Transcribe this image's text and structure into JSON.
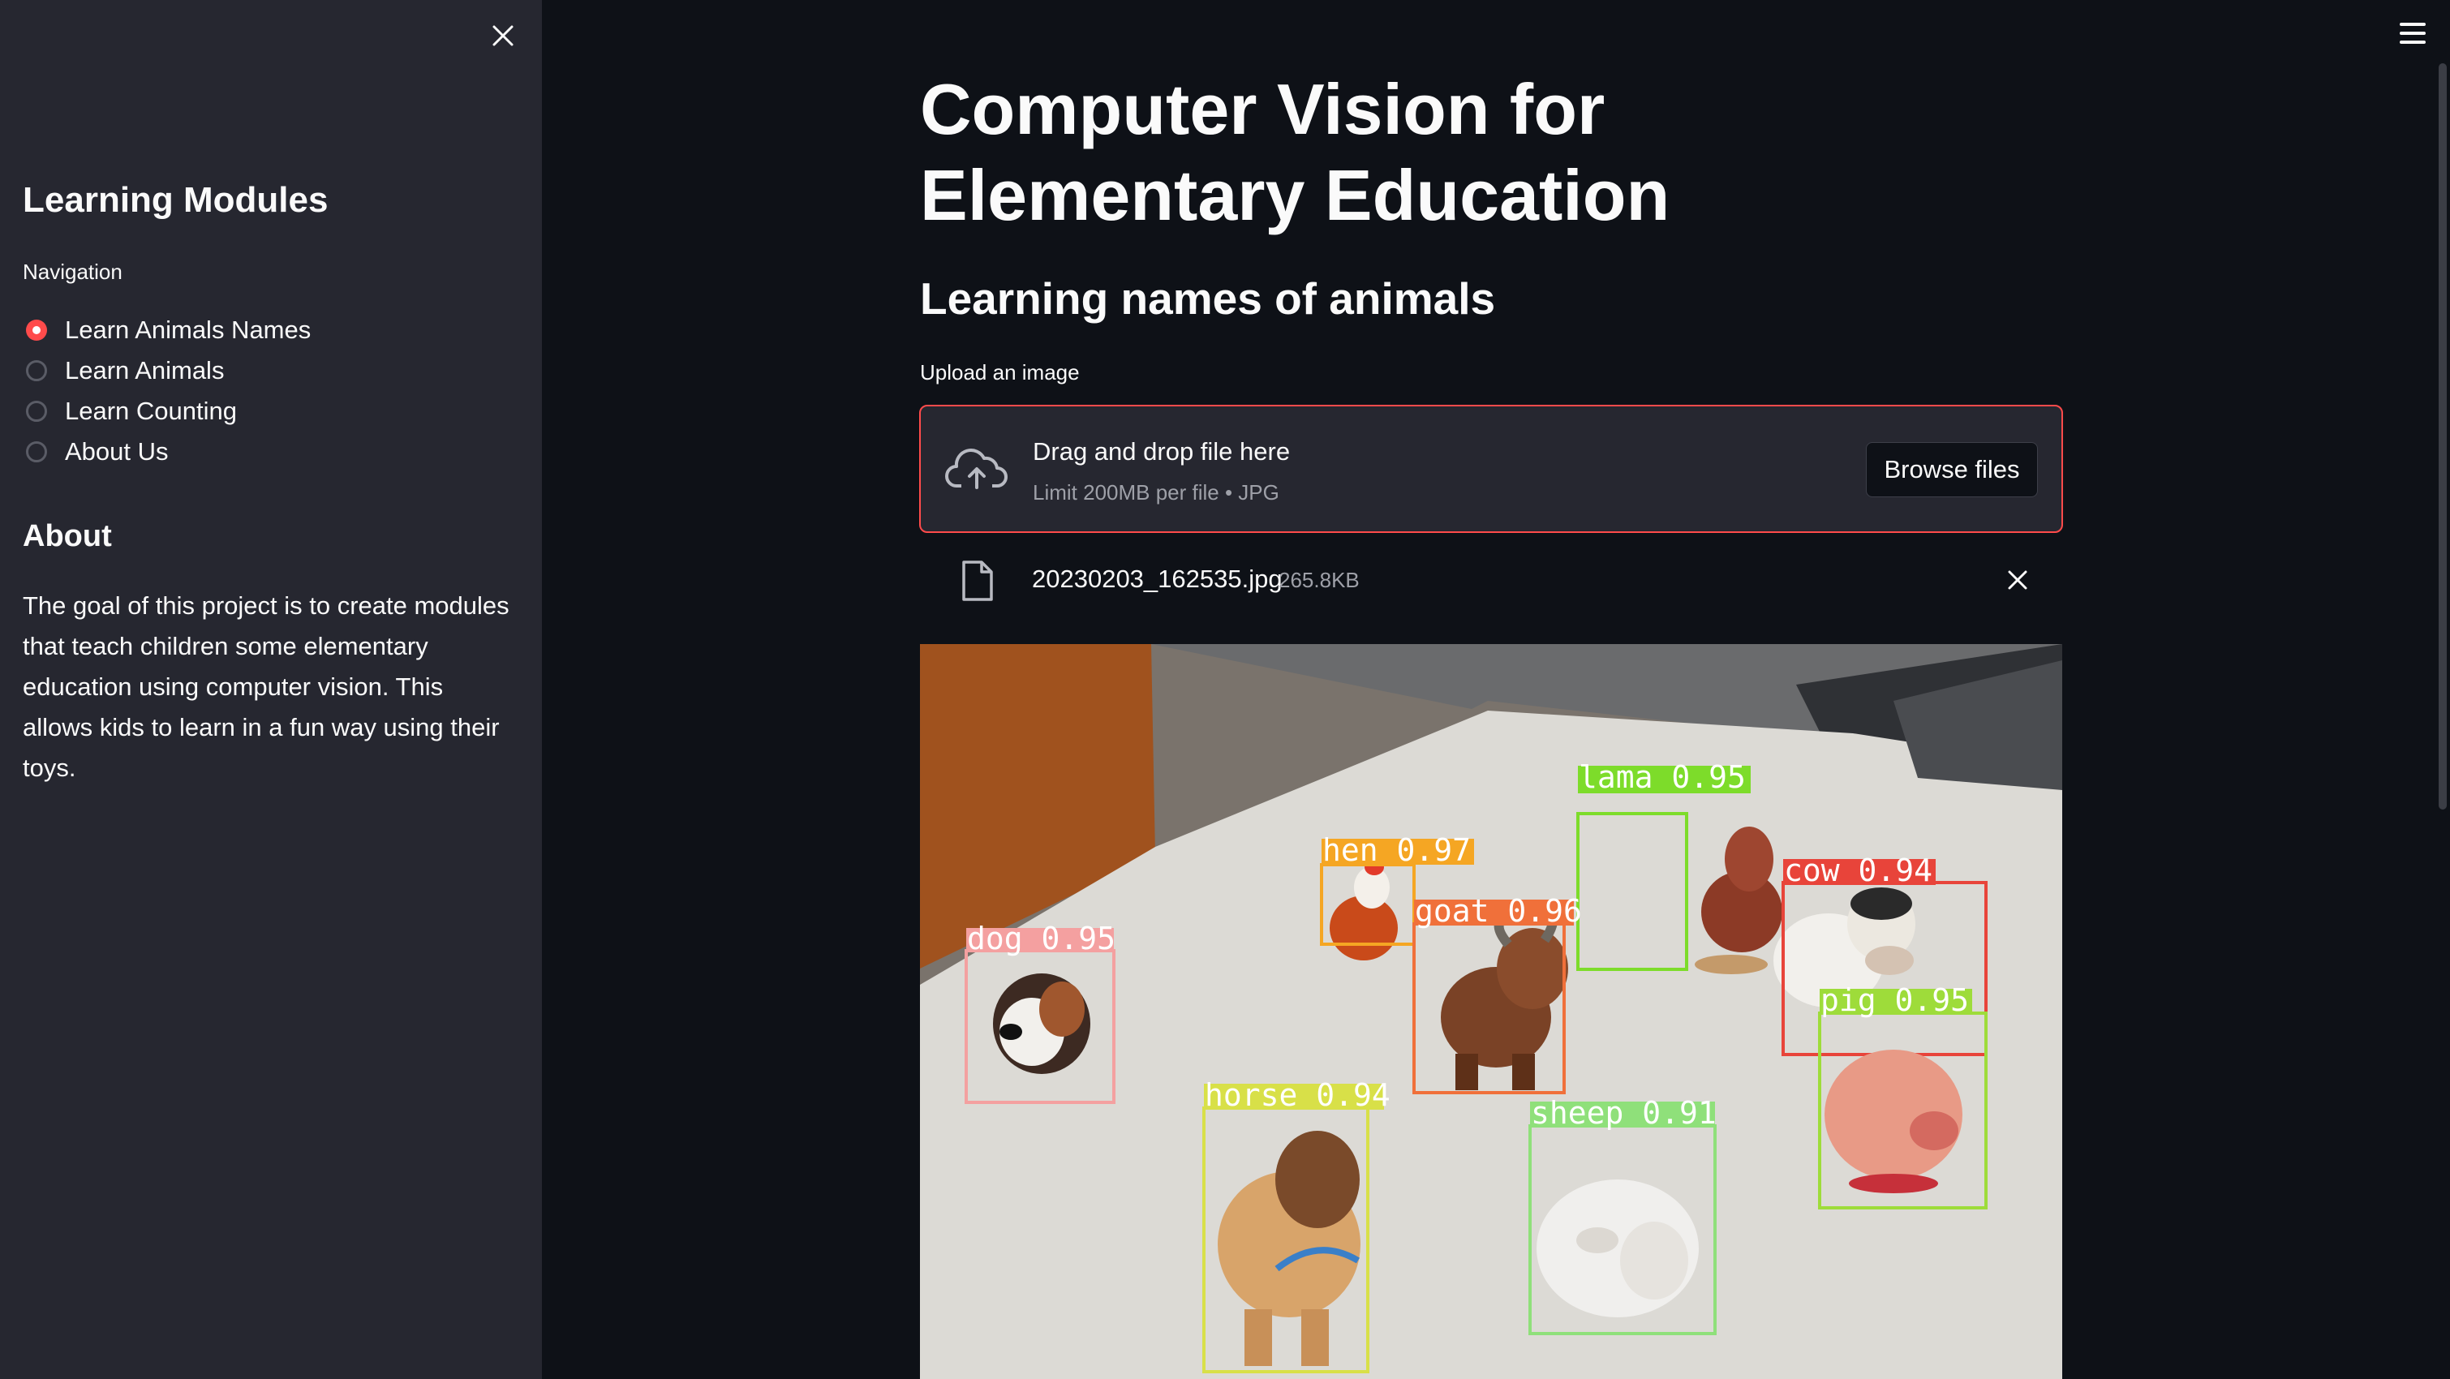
{
  "sidebar": {
    "title": "Learning Modules",
    "nav_label": "Navigation",
    "options": [
      {
        "label": "Learn Animals Names",
        "selected": true
      },
      {
        "label": "Learn Animals",
        "selected": false
      },
      {
        "label": "Learn Counting",
        "selected": false
      },
      {
        "label": "About Us",
        "selected": false
      }
    ],
    "about_title": "About",
    "about_text": "The goal of this project is to create modules that teach children some elementary education using computer vision. This allows kids to learn in a fun way using their toys."
  },
  "main": {
    "title": "Computer Vision for Elementary Education",
    "subtitle": "Learning names of animals",
    "upload_label": "Upload an image",
    "dropzone": {
      "title": "Drag and drop file here",
      "limit": "Limit 200MB per file • JPG",
      "browse_label": "Browse files"
    },
    "file": {
      "name": "20230203_162535.jpg",
      "size": "265.8KB"
    },
    "detections": [
      {
        "label": "lama 0.95",
        "color": "#7ddc2a"
      },
      {
        "label": "hen 0.97",
        "color": "#f5a623"
      },
      {
        "label": "goat 0.96",
        "color": "#f0703a"
      },
      {
        "label": "cow 0.94",
        "color": "#e8443a"
      },
      {
        "label": "dog 0.95",
        "color": "#f4a0a0"
      },
      {
        "label": "pig 0.95",
        "color": "#9edc3a"
      },
      {
        "label": "horse 0.94",
        "color": "#d8e048"
      },
      {
        "label": "sheep 0.91",
        "color": "#8fe07a"
      }
    ]
  },
  "icons": {
    "close": "close-icon",
    "menu": "hamburger-icon",
    "upload": "cloud-upload-icon",
    "file": "file-icon"
  },
  "colors": {
    "accent": "#ff4b4b",
    "background": "#0e1117",
    "sidebar": "#262730"
  }
}
